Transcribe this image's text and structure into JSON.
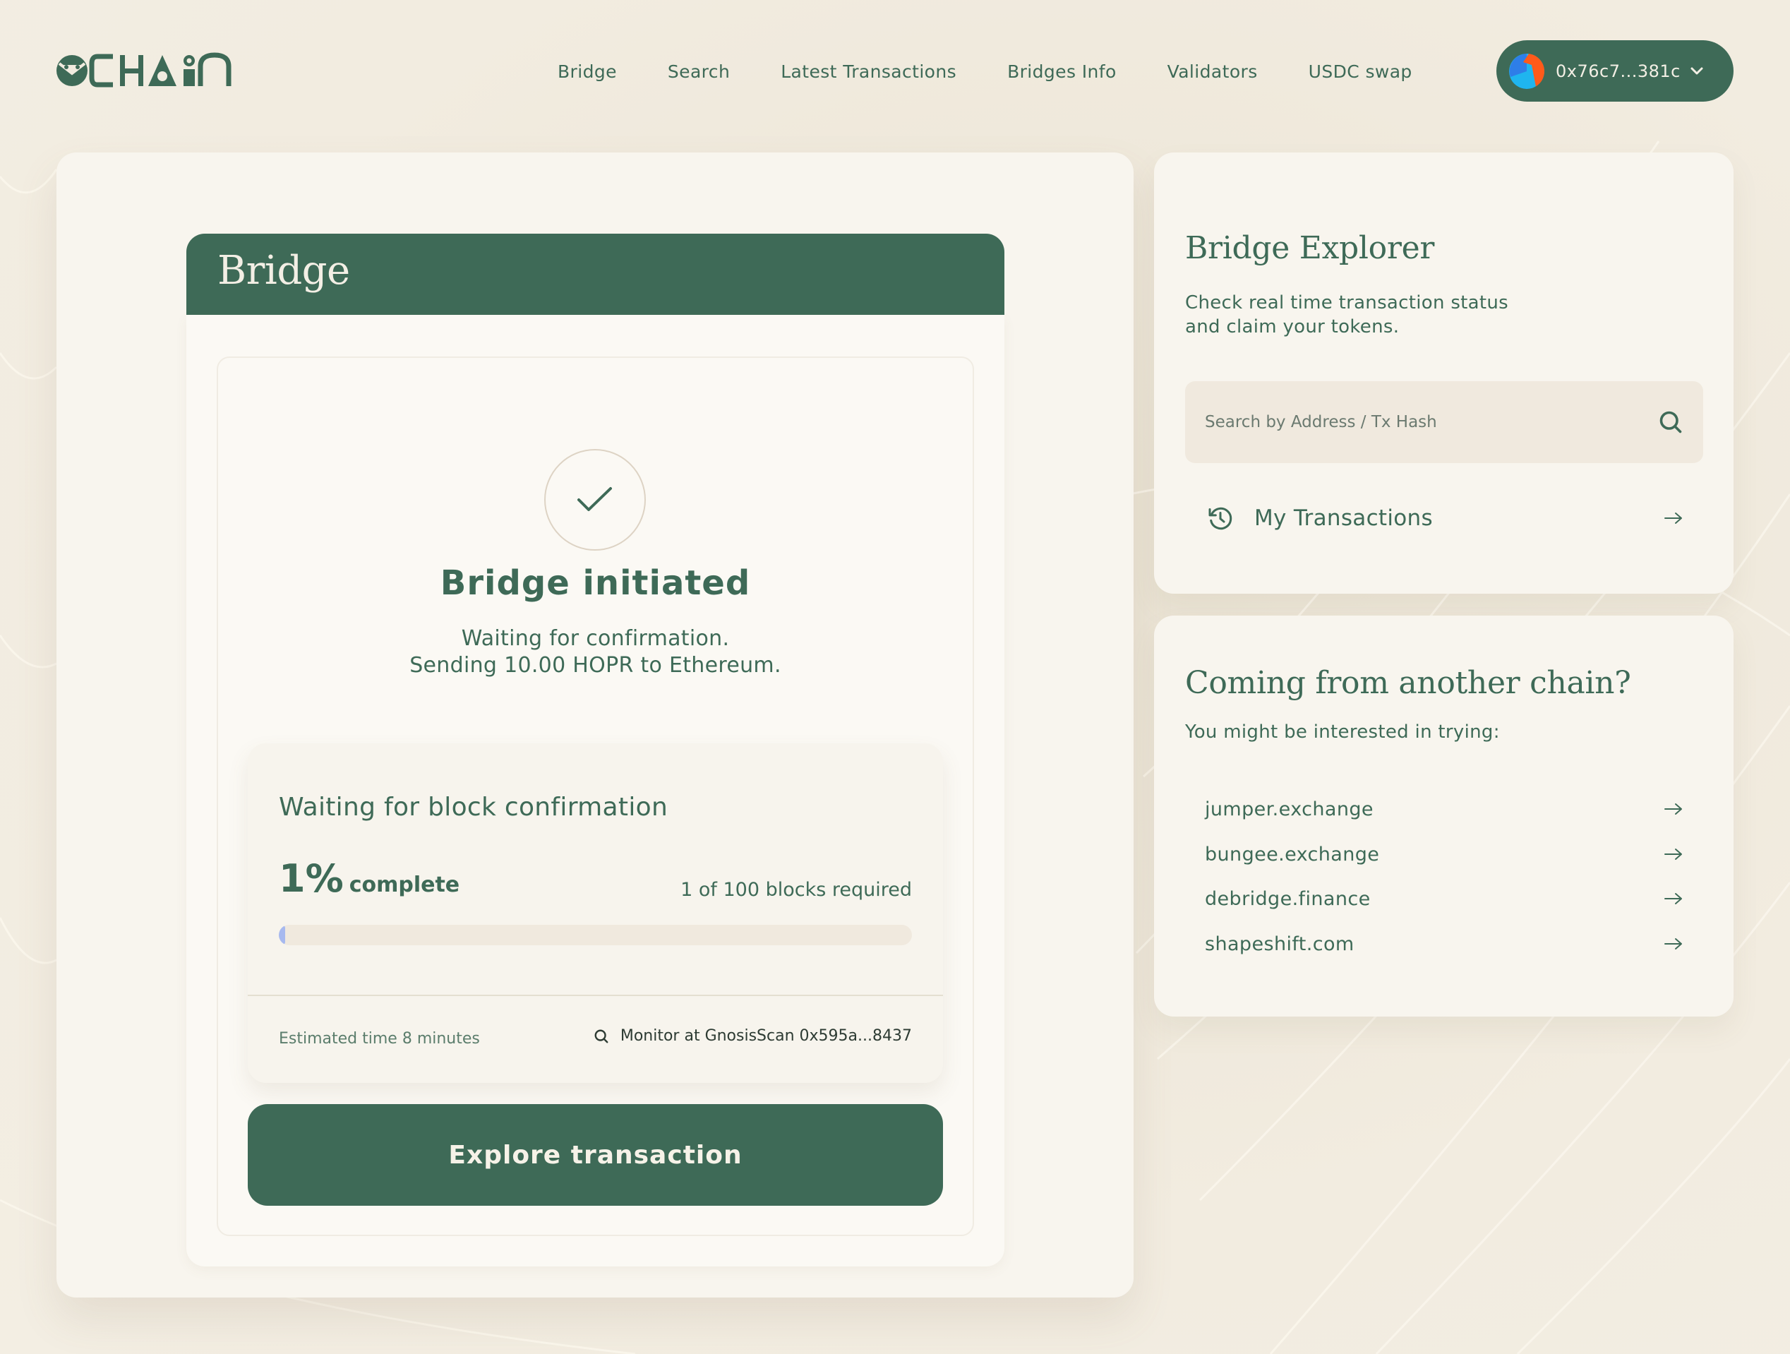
{
  "brand": {
    "name": "CHAIN",
    "logo_icon": "owl-icon"
  },
  "nav": {
    "items": [
      {
        "label": "Bridge"
      },
      {
        "label": "Search"
      },
      {
        "label": "Latest Transactions"
      },
      {
        "label": "Bridges Info"
      },
      {
        "label": "Validators"
      },
      {
        "label": "USDC swap"
      }
    ]
  },
  "wallet": {
    "address": "0x76c7...381c",
    "icon": "chevron-down-icon"
  },
  "colors": {
    "brand_green": "#3e6a57",
    "background": "#f1ebdf",
    "card": "#f8f5ee",
    "progress_fill": "#a7b9ef",
    "progress_track": "#f0e9de"
  },
  "bridge": {
    "title": "Bridge",
    "status_title": "Bridge initiated",
    "status_line1": "Waiting for confirmation.",
    "status_line2": "Sending 10.00 HOPR to Ethereum.",
    "progress": {
      "title": "Waiting for block confirmation",
      "percent_label": "1%",
      "percent_suffix": "complete",
      "percent_value": 1,
      "blocks_text": "1 of 100 blocks required",
      "estimated_time": "Estimated time 8 minutes",
      "monitor_text": "Monitor at GnosisScan 0x595a...8437"
    },
    "explore_button": "Explore transaction"
  },
  "explorer": {
    "title": "Bridge Explorer",
    "description_line1": "Check real time transaction status",
    "description_line2": "and claim your tokens.",
    "search_placeholder": "Search by Address / Tx Hash",
    "search_value": "",
    "my_transactions": "My Transactions"
  },
  "another_chain": {
    "title": "Coming from another chain?",
    "subtitle": "You might be interested in trying:",
    "links": [
      {
        "label": "jumper.exchange"
      },
      {
        "label": "bungee.exchange"
      },
      {
        "label": "debridge.finance"
      },
      {
        "label": "shapeshift.com"
      }
    ]
  }
}
